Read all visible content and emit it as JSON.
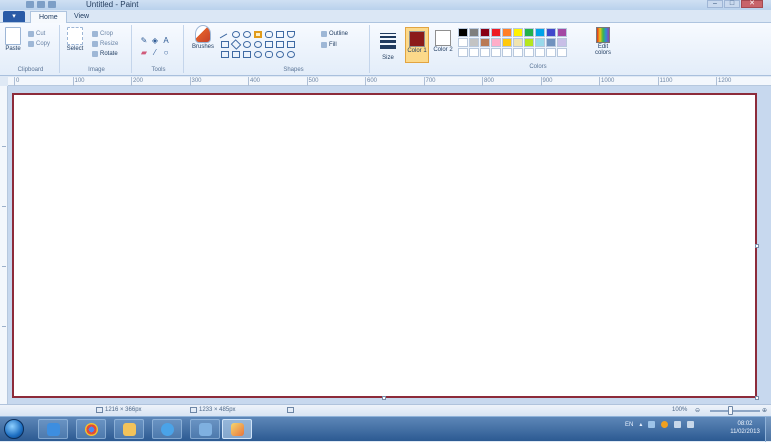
{
  "window": {
    "title": "Untitled - Paint",
    "minimize_label": "–",
    "maximize_label": "□",
    "close_label": "✕"
  },
  "tabs": {
    "file_label": "▾",
    "items": [
      {
        "label": "Home"
      },
      {
        "label": "View"
      }
    ]
  },
  "ribbon": {
    "clipboard": {
      "paste_label": "Paste",
      "cut_label": "Cut",
      "copy_label": "Copy",
      "group_label": "Clipboard"
    },
    "image": {
      "select_label": "Select",
      "crop_label": "Crop",
      "resize_label": "Resize",
      "rotate_label": "Rotate",
      "group_label": "Image"
    },
    "tools": {
      "text_tool_label": "A",
      "group_label": "Tools"
    },
    "brushes_label": "Brushes",
    "shapes": {
      "outline_label": "Outline",
      "fill_label": "Fill",
      "group_label": "Shapes"
    },
    "size_label": "Size",
    "colors": {
      "color1_label": "Color 1",
      "color2_label": "Color 2",
      "color1_value": "#8b1a1a",
      "color2_value": "#ffffff",
      "edit_colors_label": "Edit colors",
      "group_label": "Colors",
      "palette": [
        "#000000",
        "#7f7f7f",
        "#880015",
        "#ed1c24",
        "#ff7f27",
        "#fff200",
        "#22b14c",
        "#00a2e8",
        "#3f48cc",
        "#a349a4",
        "#ffffff",
        "#c3c3c3",
        "#b97a57",
        "#ffaec9",
        "#ffc90e",
        "#efe4b0",
        "#b5e61d",
        "#99d9ea",
        "#7092be",
        "#c8bfe7",
        "#ffffff",
        "#ffffff",
        "#ffffff",
        "#ffffff",
        "#ffffff",
        "#ffffff",
        "#ffffff",
        "#ffffff",
        "#ffffff",
        "#ffffff"
      ]
    }
  },
  "ruler": {
    "ticks": [
      "0",
      "100",
      "200",
      "300",
      "400",
      "500",
      "600",
      "700",
      "800",
      "900",
      "1000",
      "1100",
      "1200"
    ]
  },
  "status": {
    "cursor_position": "1216 × 366px",
    "canvas_size": "1233 × 485px",
    "zoom": "100%"
  },
  "taskbar": {
    "language": "EN",
    "time": "08:02",
    "date": "11/02/2013"
  }
}
